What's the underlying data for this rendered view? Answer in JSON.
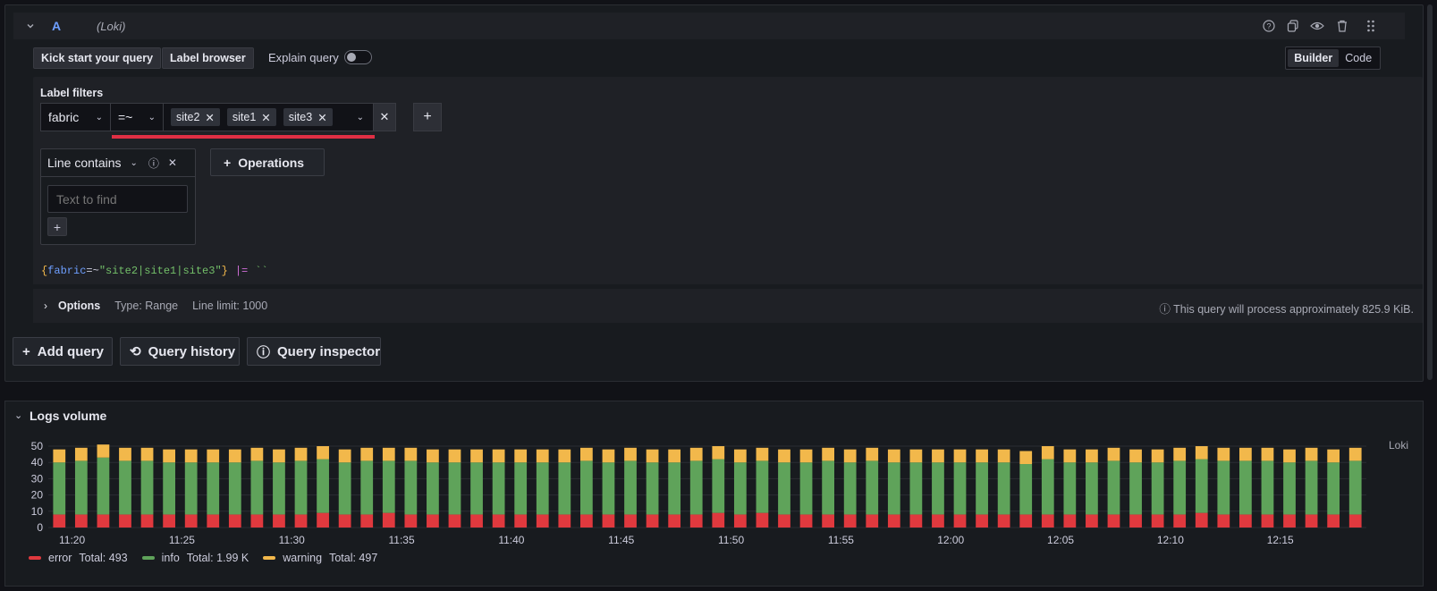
{
  "query": {
    "ref_id": "A",
    "datasource": "(Loki)",
    "kick_start_label": "Kick start your query",
    "label_browser_label": "Label browser",
    "explain_query_label": "Explain query",
    "explain_query_on": false,
    "mode_tabs": [
      "Builder",
      "Code"
    ],
    "active_mode": "Builder",
    "label_filters_title": "Label filters",
    "label_filter": {
      "label": "fabric",
      "operator": "=~",
      "values": [
        "site2",
        "site1",
        "site3"
      ]
    },
    "operation": {
      "name": "Line contains",
      "placeholder": "Text to find"
    },
    "operations_button": "Operations",
    "preview": {
      "open_brace": "{",
      "label": "fabric",
      "op": "=~",
      "value": "\"site2|site1|site3\"",
      "close_brace": "}",
      "pipe": "|=",
      "arg": "``"
    },
    "options": {
      "title": "Options",
      "type": "Type: Range",
      "line_limit": "Line limit: 1000",
      "estimate": "This query will process approximately 825.9 KiB."
    }
  },
  "actions": {
    "add_query": "Add query",
    "query_history": "Query history",
    "query_inspector": "Query inspector"
  },
  "logs_volume": {
    "title": "Logs volume",
    "source": "Loki"
  },
  "colors": {
    "error": "#f2495c",
    "info": "#73bf69",
    "warning": "#f2cc0c",
    "accent_blue": "#6e9fff",
    "highlight_red": "#e02f44"
  },
  "chart_data": {
    "type": "bar",
    "stacked": true,
    "ylim": [
      0,
      50
    ],
    "yticks": [
      0,
      10,
      20,
      30,
      40,
      50
    ],
    "x_tick_labels": [
      "11:20",
      "11:25",
      "11:30",
      "11:35",
      "11:40",
      "11:45",
      "11:50",
      "11:55",
      "12:00",
      "12:05",
      "12:10",
      "12:15"
    ],
    "bar_count": 60,
    "series": [
      {
        "name": "error",
        "total": "Total: 493",
        "color": "#e0393e",
        "values": [
          8,
          8,
          8,
          8,
          8,
          8,
          8,
          8,
          8,
          8,
          8,
          8,
          9,
          8,
          8,
          9,
          8,
          8,
          8,
          8,
          8,
          8,
          8,
          8,
          8,
          8,
          8,
          8,
          8,
          8,
          9,
          8,
          9,
          8,
          8,
          8,
          8,
          8,
          8,
          8,
          8,
          8,
          8,
          8,
          8,
          8,
          8,
          8,
          8,
          8,
          8,
          8,
          9,
          8,
          8,
          8,
          8,
          8,
          8,
          8
        ]
      },
      {
        "name": "info",
        "total": "Total: 1.99 K",
        "color": "#5fa35a",
        "values": [
          32,
          33,
          35,
          33,
          33,
          32,
          32,
          32,
          32,
          33,
          32,
          33,
          33,
          32,
          33,
          32,
          33,
          32,
          32,
          32,
          32,
          32,
          32,
          32,
          33,
          32,
          33,
          32,
          32,
          33,
          33,
          32,
          32,
          32,
          32,
          33,
          32,
          33,
          32,
          32,
          32,
          32,
          32,
          32,
          31,
          34,
          32,
          32,
          33,
          32,
          32,
          33,
          33,
          33,
          33,
          33,
          32,
          33,
          32,
          33,
          32,
          32
        ]
      },
      {
        "name": "warning",
        "total": "Total: 497",
        "color": "#f2b84b",
        "values": [
          8,
          8,
          8,
          8,
          8,
          8,
          8,
          8,
          8,
          8,
          8,
          8,
          8,
          8,
          8,
          8,
          8,
          8,
          8,
          8,
          8,
          8,
          8,
          8,
          8,
          8,
          8,
          8,
          8,
          8,
          8,
          8,
          8,
          8,
          8,
          8,
          8,
          8,
          8,
          8,
          8,
          8,
          8,
          8,
          8,
          8,
          8,
          8,
          8,
          8,
          8,
          8,
          8,
          8,
          8,
          8,
          8,
          8,
          8,
          8
        ]
      }
    ]
  }
}
